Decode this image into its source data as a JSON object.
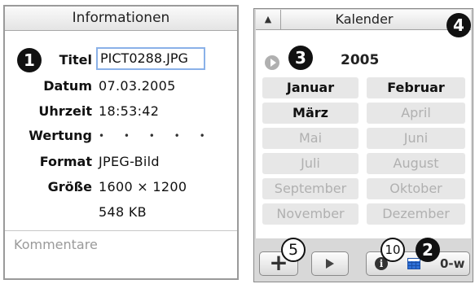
{
  "info_panel": {
    "title": "Informationen",
    "fields": [
      {
        "label": "Titel",
        "value": "PICT0288.JPG"
      },
      {
        "label": "Datum",
        "value": "07.03.2005"
      },
      {
        "label": "Uhrzeit",
        "value": "18:53:42"
      },
      {
        "label": "Wertung",
        "value": "• • • • •"
      },
      {
        "label": "Format",
        "value": "JPEG-Bild"
      },
      {
        "label": "Größe",
        "value": "1600 × 1200",
        "value2": "548 KB"
      }
    ],
    "comment_label": "Kommentare"
  },
  "calendar": {
    "title": "Kalender",
    "year": "2005",
    "months": [
      {
        "name": "Januar",
        "active": true
      },
      {
        "name": "Februar",
        "active": true
      },
      {
        "name": "März",
        "active": true
      },
      {
        "name": "April",
        "active": false
      },
      {
        "name": "Mai",
        "active": false
      },
      {
        "name": "Juni",
        "active": false
      },
      {
        "name": "Juli",
        "active": false
      },
      {
        "name": "August",
        "active": false
      },
      {
        "name": "September",
        "active": false
      },
      {
        "name": "Oktober",
        "active": false
      },
      {
        "name": "November",
        "active": false
      },
      {
        "name": "Dezember",
        "active": false
      }
    ]
  },
  "toolbar": {
    "add_label": "+",
    "info_label": "i",
    "key_label": "0-w"
  },
  "callouts": {
    "one": "1",
    "two": "2",
    "three": "3",
    "four": "4",
    "five": "5",
    "ten": "10"
  },
  "icons": {
    "collapse": "triangle-up-icon",
    "year_back": "play-circle-icon",
    "add": "plus-icon",
    "slideshow": "play-icon",
    "info": "info-icon",
    "calendar": "calendar-icon",
    "keywords": "key-icon"
  },
  "colors": {
    "selection_border": "#8ab1e8",
    "calendar_blue": "#2e6fd6",
    "inactive_month_text": "#b0b0b0"
  }
}
